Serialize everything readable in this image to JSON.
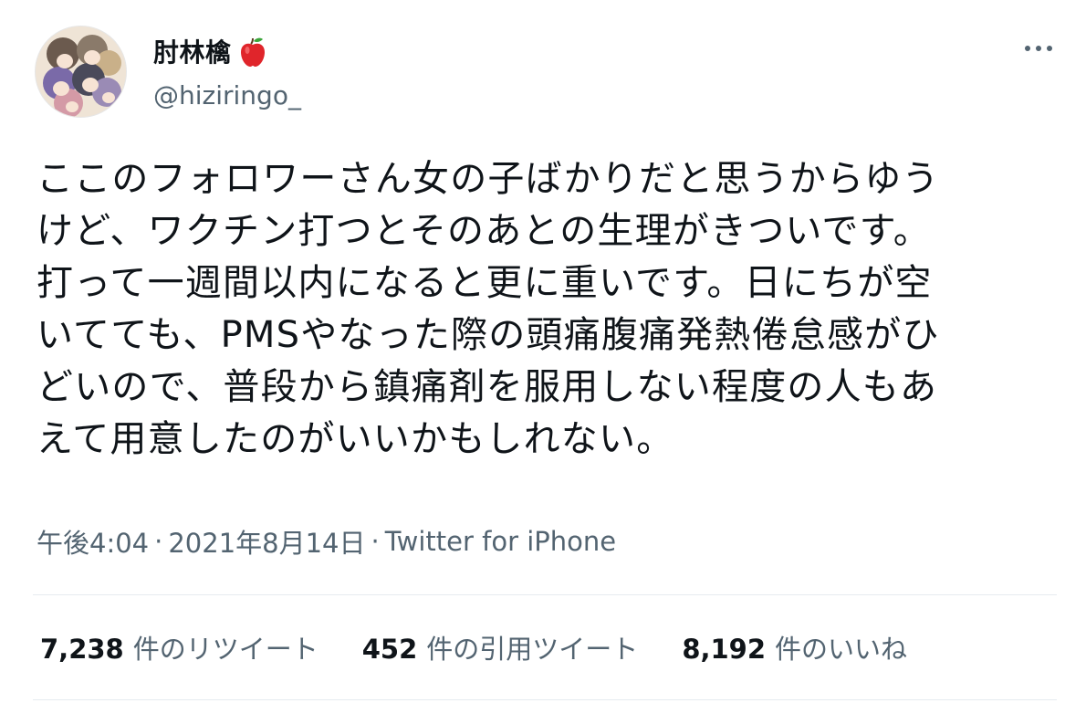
{
  "author": {
    "display_name": "肘林檎",
    "emoji_icon": "red-apple-icon",
    "handle": "@hiziringo_",
    "avatar_icon": "group-illustration-avatar"
  },
  "tweet": {
    "text_lines": [
      "ここのフォロワーさん女の子ばかりだと思うからゆう",
      "けど、ワクチン打つとそのあとの生理がきついです。",
      "打って一週間以内になると更に重いです。日にちが空",
      "いてても、PMSやなった際の頭痛腹痛発熱倦怠感がひ",
      "どいので、普段から鎮痛剤を服用しない程度の人もあ",
      "えて用意したのがいいかもしれない。"
    ],
    "time": "午後4:04",
    "separator": "·",
    "date": "2021年8月14日",
    "source": "Twitter for iPhone"
  },
  "stats": {
    "retweets": {
      "count": "7,238",
      "label": "件のリツイート"
    },
    "quotes": {
      "count": "452",
      "label": "件の引用ツイート"
    },
    "likes": {
      "count": "8,192",
      "label": "件のいいね"
    }
  },
  "colors": {
    "text_primary": "#0f1419",
    "text_secondary": "#536471",
    "divider": "#e6ecf0",
    "apple_red": "#e0252b"
  }
}
